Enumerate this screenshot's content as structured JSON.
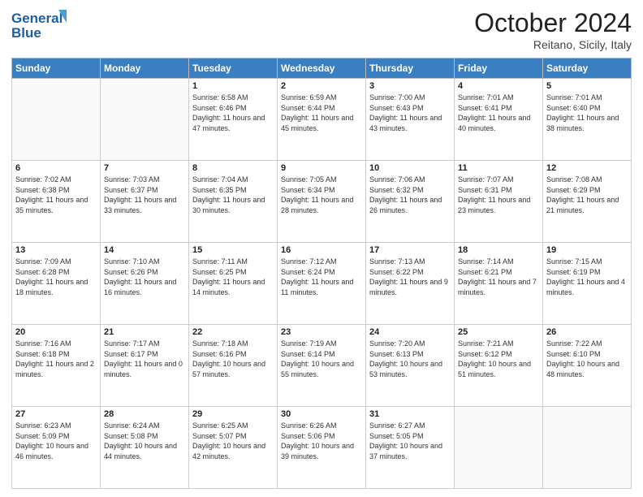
{
  "header": {
    "logo_line1": "General",
    "logo_line2": "Blue",
    "month": "October 2024",
    "location": "Reitano, Sicily, Italy"
  },
  "weekdays": [
    "Sunday",
    "Monday",
    "Tuesday",
    "Wednesday",
    "Thursday",
    "Friday",
    "Saturday"
  ],
  "weeks": [
    [
      {
        "day": "",
        "info": ""
      },
      {
        "day": "",
        "info": ""
      },
      {
        "day": "1",
        "info": "Sunrise: 6:58 AM\nSunset: 6:46 PM\nDaylight: 11 hours and 47 minutes."
      },
      {
        "day": "2",
        "info": "Sunrise: 6:59 AM\nSunset: 6:44 PM\nDaylight: 11 hours and 45 minutes."
      },
      {
        "day": "3",
        "info": "Sunrise: 7:00 AM\nSunset: 6:43 PM\nDaylight: 11 hours and 43 minutes."
      },
      {
        "day": "4",
        "info": "Sunrise: 7:01 AM\nSunset: 6:41 PM\nDaylight: 11 hours and 40 minutes."
      },
      {
        "day": "5",
        "info": "Sunrise: 7:01 AM\nSunset: 6:40 PM\nDaylight: 11 hours and 38 minutes."
      }
    ],
    [
      {
        "day": "6",
        "info": "Sunrise: 7:02 AM\nSunset: 6:38 PM\nDaylight: 11 hours and 35 minutes."
      },
      {
        "day": "7",
        "info": "Sunrise: 7:03 AM\nSunset: 6:37 PM\nDaylight: 11 hours and 33 minutes."
      },
      {
        "day": "8",
        "info": "Sunrise: 7:04 AM\nSunset: 6:35 PM\nDaylight: 11 hours and 30 minutes."
      },
      {
        "day": "9",
        "info": "Sunrise: 7:05 AM\nSunset: 6:34 PM\nDaylight: 11 hours and 28 minutes."
      },
      {
        "day": "10",
        "info": "Sunrise: 7:06 AM\nSunset: 6:32 PM\nDaylight: 11 hours and 26 minutes."
      },
      {
        "day": "11",
        "info": "Sunrise: 7:07 AM\nSunset: 6:31 PM\nDaylight: 11 hours and 23 minutes."
      },
      {
        "day": "12",
        "info": "Sunrise: 7:08 AM\nSunset: 6:29 PM\nDaylight: 11 hours and 21 minutes."
      }
    ],
    [
      {
        "day": "13",
        "info": "Sunrise: 7:09 AM\nSunset: 6:28 PM\nDaylight: 11 hours and 18 minutes."
      },
      {
        "day": "14",
        "info": "Sunrise: 7:10 AM\nSunset: 6:26 PM\nDaylight: 11 hours and 16 minutes."
      },
      {
        "day": "15",
        "info": "Sunrise: 7:11 AM\nSunset: 6:25 PM\nDaylight: 11 hours and 14 minutes."
      },
      {
        "day": "16",
        "info": "Sunrise: 7:12 AM\nSunset: 6:24 PM\nDaylight: 11 hours and 11 minutes."
      },
      {
        "day": "17",
        "info": "Sunrise: 7:13 AM\nSunset: 6:22 PM\nDaylight: 11 hours and 9 minutes."
      },
      {
        "day": "18",
        "info": "Sunrise: 7:14 AM\nSunset: 6:21 PM\nDaylight: 11 hours and 7 minutes."
      },
      {
        "day": "19",
        "info": "Sunrise: 7:15 AM\nSunset: 6:19 PM\nDaylight: 11 hours and 4 minutes."
      }
    ],
    [
      {
        "day": "20",
        "info": "Sunrise: 7:16 AM\nSunset: 6:18 PM\nDaylight: 11 hours and 2 minutes."
      },
      {
        "day": "21",
        "info": "Sunrise: 7:17 AM\nSunset: 6:17 PM\nDaylight: 11 hours and 0 minutes."
      },
      {
        "day": "22",
        "info": "Sunrise: 7:18 AM\nSunset: 6:16 PM\nDaylight: 10 hours and 57 minutes."
      },
      {
        "day": "23",
        "info": "Sunrise: 7:19 AM\nSunset: 6:14 PM\nDaylight: 10 hours and 55 minutes."
      },
      {
        "day": "24",
        "info": "Sunrise: 7:20 AM\nSunset: 6:13 PM\nDaylight: 10 hours and 53 minutes."
      },
      {
        "day": "25",
        "info": "Sunrise: 7:21 AM\nSunset: 6:12 PM\nDaylight: 10 hours and 51 minutes."
      },
      {
        "day": "26",
        "info": "Sunrise: 7:22 AM\nSunset: 6:10 PM\nDaylight: 10 hours and 48 minutes."
      }
    ],
    [
      {
        "day": "27",
        "info": "Sunrise: 6:23 AM\nSunset: 5:09 PM\nDaylight: 10 hours and 46 minutes."
      },
      {
        "day": "28",
        "info": "Sunrise: 6:24 AM\nSunset: 5:08 PM\nDaylight: 10 hours and 44 minutes."
      },
      {
        "day": "29",
        "info": "Sunrise: 6:25 AM\nSunset: 5:07 PM\nDaylight: 10 hours and 42 minutes."
      },
      {
        "day": "30",
        "info": "Sunrise: 6:26 AM\nSunset: 5:06 PM\nDaylight: 10 hours and 39 minutes."
      },
      {
        "day": "31",
        "info": "Sunrise: 6:27 AM\nSunset: 5:05 PM\nDaylight: 10 hours and 37 minutes."
      },
      {
        "day": "",
        "info": ""
      },
      {
        "day": "",
        "info": ""
      }
    ]
  ]
}
